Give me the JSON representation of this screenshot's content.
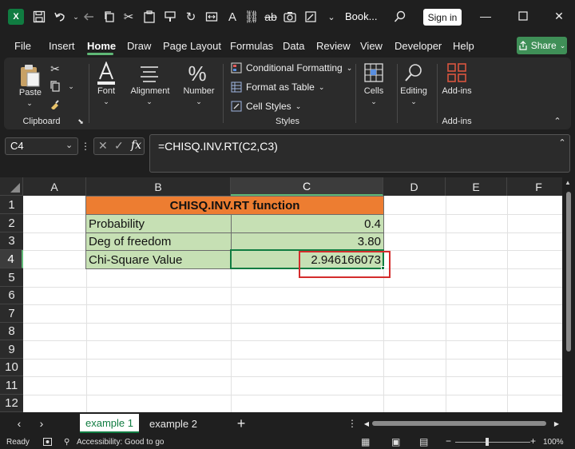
{
  "titlebar": {
    "logo": "X",
    "book_title": "Book...",
    "signin_label": "Sign in",
    "icons": [
      "excel-logo",
      "save-icon",
      "undo-icon",
      "redo-icon",
      "copy-icon",
      "cut-icon",
      "paste-icon",
      "strikethrough-icon",
      "camera-icon",
      "more-icon",
      "search-icon",
      "minimize-icon",
      "maximize-icon",
      "close-icon"
    ]
  },
  "menu": {
    "tabs": [
      "File",
      "Insert",
      "Home",
      "Draw",
      "Page Layout",
      "Formulas",
      "Data",
      "Review",
      "View",
      "Developer",
      "Help"
    ],
    "active": "Home",
    "share_label": "Share"
  },
  "ribbon": {
    "clipboard": {
      "paste_label": "Paste",
      "group_label": "Clipboard"
    },
    "font_label": "Font",
    "alignment_label": "Alignment",
    "number_label": "Number",
    "styles": {
      "conditional_formatting": "Conditional Formatting",
      "format_as_table": "Format as Table",
      "cell_styles": "Cell Styles",
      "group_label": "Styles"
    },
    "cells_label": "Cells",
    "editing_label": "Editing",
    "addins_label": "Add-ins",
    "addins_group_label": "Add-ins"
  },
  "formula_bar": {
    "name_box": "C4",
    "fx": "fx",
    "formula": "=CHISQ.INV.RT(C2,C3)"
  },
  "grid": {
    "columns": [
      "A",
      "B",
      "C",
      "D",
      "E",
      "F"
    ],
    "rows": [
      "1",
      "2",
      "3",
      "4",
      "5",
      "6",
      "7",
      "8",
      "9",
      "10",
      "11",
      "12"
    ],
    "selected_column": "C",
    "selected_row": "4",
    "header_text": "CHISQ.INV.RT function",
    "table": [
      {
        "label": "Probability",
        "value": "0.4"
      },
      {
        "label": "Deg of freedom",
        "value": "3.80"
      },
      {
        "label": "Chi-Square Value",
        "value": "2.946166073"
      }
    ],
    "colors": {
      "header_fill": "#ed7d31",
      "body_fill": "#c6e0b4",
      "highlight_border": "#d42c2c",
      "selection": "#107c41"
    }
  },
  "sheets": {
    "tabs": [
      "example 1",
      "example 2"
    ],
    "active": "example 1",
    "add_label": "+"
  },
  "status": {
    "ready": "Ready",
    "accessibility": "Accessibility: Good to go",
    "zoom": "100%"
  }
}
